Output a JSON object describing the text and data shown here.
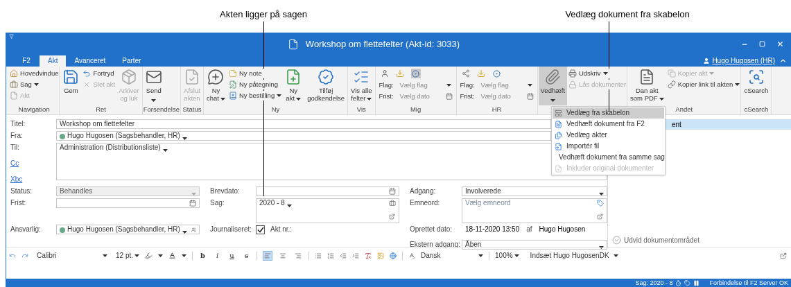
{
  "callouts": [
    {
      "text": "Akten ligger på sagen"
    },
    {
      "text": "Vedlæg dokument fra skabelon"
    }
  ],
  "window": {
    "title": "Workshop om flettefelter (Akt-id: 3033)",
    "user": "Hugo Hugosen (HR)"
  },
  "tabs": [
    {
      "label": "F2",
      "selected": false
    },
    {
      "label": "Akt",
      "selected": true
    },
    {
      "label": "Avanceret",
      "selected": false
    },
    {
      "label": "Parter",
      "selected": false
    }
  ],
  "ribbon": [
    {
      "label": "Navigation",
      "columns": [
        {
          "kind": "stack",
          "items": [
            {
              "label": "Hovedvindue",
              "disabled": false,
              "dropdown": false
            },
            {
              "label": "Sag",
              "disabled": false,
              "dropdown": true
            },
            {
              "label": "Akt",
              "disabled": true,
              "dropdown": false
            }
          ]
        }
      ]
    },
    {
      "label": "Ret",
      "columns": [
        {
          "kind": "large",
          "label": "Gem",
          "disabled": false,
          "expanded": false
        },
        {
          "kind": "stack",
          "items": [
            {
              "label": "Fortryd",
              "disabled": false,
              "dropdown": false
            },
            {
              "label": "Slet akt",
              "disabled": true,
              "dropdown": false
            }
          ]
        },
        {
          "kind": "large",
          "label": "Arkiver\nog luk",
          "disabled": true,
          "expanded": false
        }
      ]
    },
    {
      "label": "Forsendelse",
      "columns": [
        {
          "kind": "split",
          "label": "Send",
          "disabled": false,
          "expanded": false,
          "dropdown": true
        }
      ]
    },
    {
      "label": "Status",
      "columns": [
        {
          "kind": "large",
          "label": "Afslut\nakten",
          "disabled": true,
          "expanded": false
        }
      ]
    },
    {
      "label": "Ny",
      "columns": [
        {
          "kind": "large",
          "label": "Ny\nchat",
          "disabled": false,
          "expanded": false,
          "dropdown": true
        },
        {
          "kind": "stack",
          "items": [
            {
              "label": "Ny note",
              "disabled": false,
              "dropdown": false
            },
            {
              "label": "Ny påtegning",
              "disabled": false,
              "dropdown": false
            },
            {
              "label": "Ny bestilling",
              "disabled": false,
              "dropdown": true
            }
          ]
        },
        {
          "kind": "large",
          "label": "Ny\nakt",
          "disabled": false,
          "expanded": false,
          "dropdown": true
        },
        {
          "kind": "large",
          "label": "Tilføj\ngodkendelse",
          "disabled": false,
          "expanded": false
        }
      ]
    },
    {
      "label": "Vis",
      "columns": [
        {
          "kind": "large",
          "label": "Vis alle\nfelter",
          "disabled": false,
          "expanded": false,
          "dropdown": true
        }
      ]
    },
    {
      "label": "Mig",
      "columns": [
        {
          "kind": "flags",
          "rows": [
            {
              "label": "Flag:",
              "value": "Vælg flag"
            },
            {
              "label": "Frist:",
              "value": "Vælg dato"
            }
          ]
        }
      ]
    },
    {
      "label": "HR",
      "columns": [
        {
          "kind": "flags",
          "rows": [
            {
              "label": "Flag:",
              "value": "Vælg flag"
            },
            {
              "label": "Frist:",
              "value": "Vælg dato"
            }
          ]
        }
      ]
    },
    {
      "columns": [
        {
          "kind": "split",
          "label": "Vedhæft",
          "disabled": false,
          "expanded": true,
          "dropdown": true
        },
        {
          "kind": "stack",
          "items": [
            {
              "label": "Udskriv",
              "disabled": false,
              "dropdown": true
            },
            {
              "label": "Lås dokumenter",
              "disabled": true,
              "dropdown": false
            }
          ]
        }
      ]
    },
    {
      "label": "Andet",
      "columns": [
        {
          "kind": "large",
          "label": "Dan akt\nsom PDF",
          "disabled": false,
          "expanded": false,
          "dropdown": true
        },
        {
          "kind": "stack",
          "items": [
            {
              "label": "Kopier akt",
              "disabled": true,
              "dropdown": true
            },
            {
              "label": "Kopier link til akten",
              "disabled": false,
              "dropdown": true
            }
          ]
        }
      ]
    },
    {
      "label": "cSearch",
      "columns": [
        {
          "kind": "large",
          "label": "cSearch",
          "disabled": false,
          "expanded": false
        }
      ]
    }
  ],
  "attach_menu": [
    {
      "label": "Vedlæg fra skabelon",
      "selected": true,
      "disabled": false
    },
    {
      "label": "Vedhæft dokument fra F2",
      "selected": false,
      "disabled": false
    },
    {
      "label": "Vedlæg akter",
      "selected": false,
      "disabled": false
    },
    {
      "label": "Importér fil",
      "selected": false,
      "disabled": false
    },
    {
      "label": "Vedhæft dokument fra samme sag",
      "selected": false,
      "disabled": false
    },
    {
      "label": "Inkluder original dokumenter",
      "selected": false,
      "disabled": true
    }
  ],
  "form": {
    "title": {
      "label": "Titel:",
      "value": "Workshop om flettefelter"
    },
    "from": {
      "label": "Fra:",
      "value": "Hugo Hugosen (Sagsbehandler, HR)"
    },
    "to": {
      "label": "Til:",
      "value": "Administration (Distributionsliste)"
    },
    "cc": "Cc",
    "bcc": "Xbc",
    "status": {
      "label": "Status:",
      "value": "Behandles",
      "disabled": true
    },
    "deadline": {
      "label": "Frist:"
    },
    "responsible": {
      "label": "Ansvarlig:",
      "value": "Hugo Hugosen (Sagsbehandler, HR)"
    },
    "letter_date": {
      "label": "Brevdato:"
    },
    "case": {
      "label": "Sag:",
      "value": "2020 - 8"
    },
    "journalized": {
      "label": "Journaliseret:",
      "checked": true,
      "doc_no_label": "Akt nr.:"
    },
    "access": {
      "label": "Adgang:",
      "value": "Involverede"
    },
    "keywords": {
      "label": "Emneord:",
      "placeholder": "Vælg emneord"
    },
    "created": {
      "label": "Oprettet dato:",
      "value": "18-11-2020 13:50",
      "by_label": "af",
      "by": "Hugo Hugosen"
    },
    "external_access": {
      "label": "Ekstern adgang:",
      "value": "Åben"
    }
  },
  "documents": [
    {
      "text": "ent",
      "selected": true
    }
  ],
  "expand_link": "Udvid dokumentområdet",
  "editor_toolbar": {
    "font": "Calibri",
    "size": "12 pt.",
    "styles": [
      {
        "label": "b",
        "selected": false
      },
      {
        "label": "i",
        "selected": false
      },
      {
        "label": "u",
        "selected": false
      },
      {
        "label": "s",
        "selected": false
      }
    ],
    "align": [
      {
        "selected": true
      },
      {
        "selected": false
      },
      {
        "selected": false
      }
    ],
    "language": "Dansk",
    "zoom": "100%",
    "insert": "Indsæt Hugo HugosenDK"
  },
  "status_bar": {
    "case": "Sag: 2020 - 8",
    "connection": "Forbindelse til F2 Server OK"
  }
}
